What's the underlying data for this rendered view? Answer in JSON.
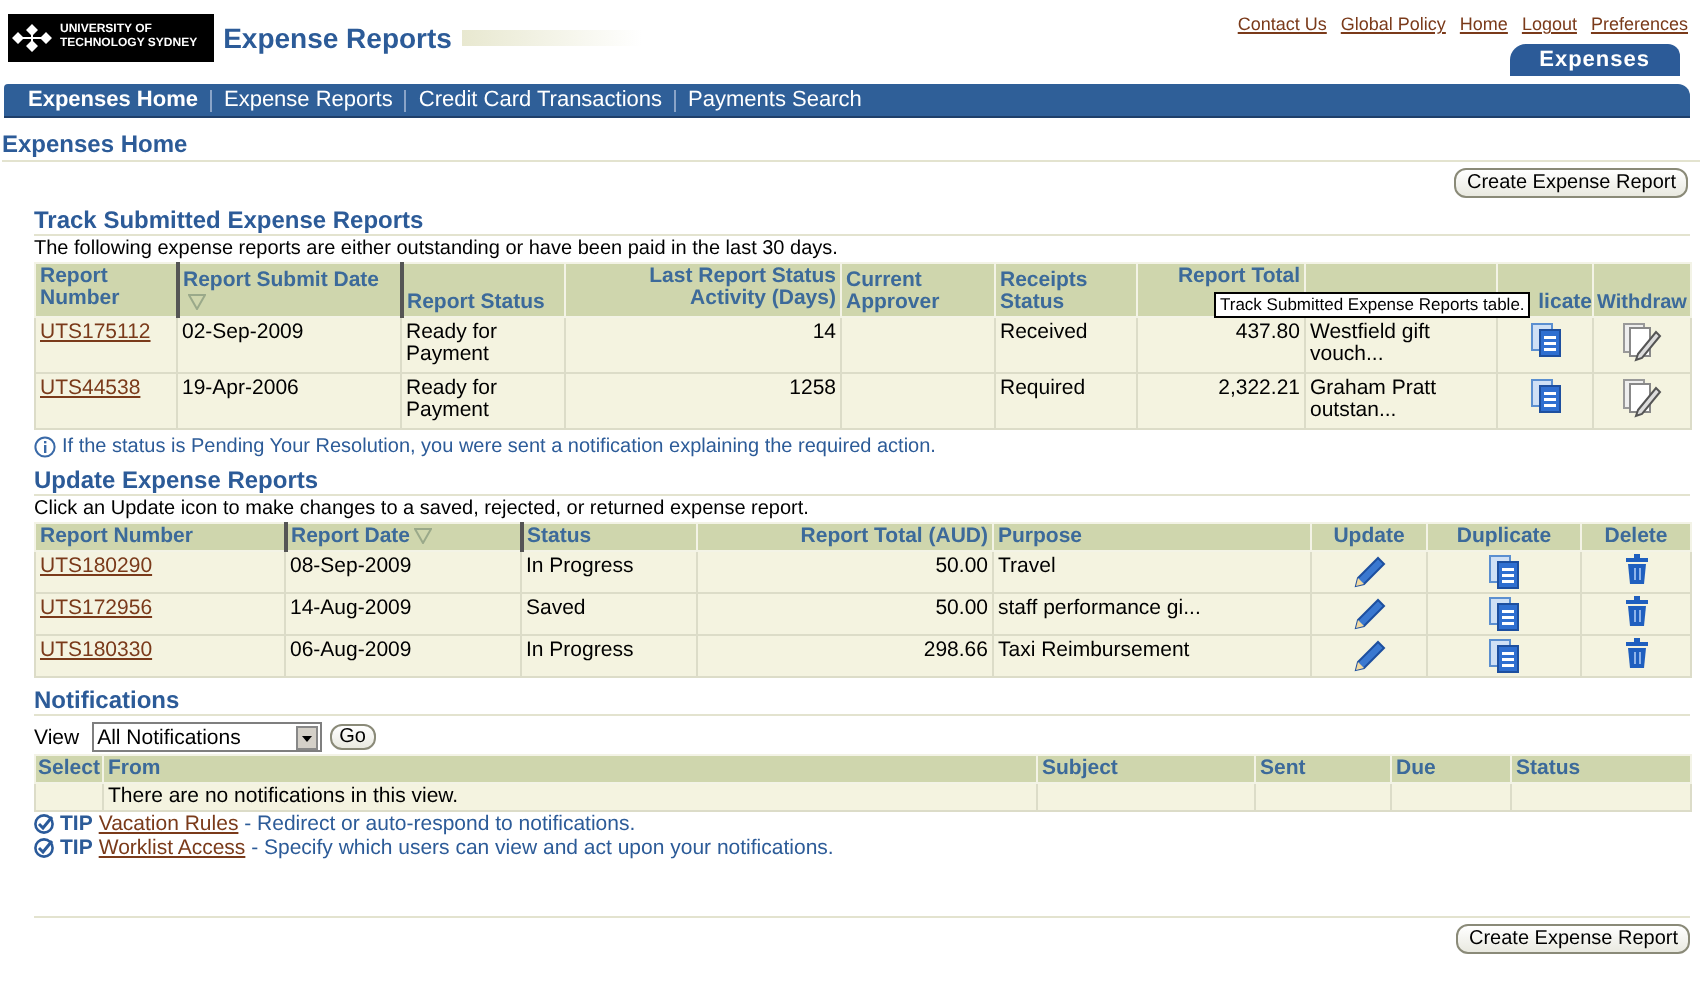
{
  "header": {
    "logo_lines": [
      "UNIVERSITY OF",
      "TECHNOLOGY SYDNEY"
    ],
    "title": "Expense Reports"
  },
  "global_links": [
    "Contact Us",
    "Global Policy",
    "Home",
    "Logout",
    "Preferences"
  ],
  "tabs": [
    {
      "label": "Expenses",
      "selected": true
    }
  ],
  "nav": [
    {
      "label": "Expenses Home",
      "selected": true
    },
    {
      "label": "Expense Reports",
      "selected": false
    },
    {
      "label": "Credit Card Transactions",
      "selected": false
    },
    {
      "label": "Payments Search",
      "selected": false
    }
  ],
  "page_title": "Expenses Home",
  "top_button": "Create Expense Report",
  "track": {
    "title": "Track Submitted Expense Reports",
    "description": "The following expense reports are either outstanding or have been paid in the last 30 days.",
    "columns": [
      {
        "label": "Report Number",
        "kind": "link",
        "sorted": false
      },
      {
        "label": "Report Submit Date",
        "kind": "text",
        "sorted": true
      },
      {
        "label": "Report Status",
        "kind": "text",
        "sorted": false
      },
      {
        "label": "Last Report Status Activity (Days)",
        "kind": "number",
        "sorted": false
      },
      {
        "label": "Current Approver",
        "kind": "text",
        "sorted": false
      },
      {
        "label": "Receipts Status",
        "kind": "text",
        "sorted": false
      },
      {
        "label": "Report Total",
        "kind": "number",
        "sorted": false
      },
      {
        "kind": "text"
      },
      {
        "label": "licate",
        "kind": "duplicate",
        "sorted": false
      },
      {
        "label": "Withdraw",
        "kind": "withdraw",
        "sorted": false
      }
    ],
    "rows": [
      {
        "cells": [
          "UTS175112",
          "02-Sep-2009",
          "Ready for Payment",
          "14",
          null,
          "Received",
          "437.80",
          "Westfield gift vouch..."
        ]
      },
      {
        "cells": [
          "UTS44538",
          "19-Apr-2006",
          "Ready for Payment",
          "1258",
          null,
          "Required",
          "2,322.21",
          "Graham Pratt outstan..."
        ]
      }
    ],
    "tooltip": "Track Submitted Expense Reports table.",
    "note": "If the status is Pending Your Resolution, you were sent a notification explaining the required action."
  },
  "update": {
    "title": "Update Expense Reports",
    "description": "Click an Update icon to make changes to a saved, rejected, or returned expense report.",
    "columns": [
      {
        "label": "Report Number",
        "kind": "link",
        "sorted": false
      },
      {
        "label": "Report Date",
        "kind": "text",
        "sorted": true
      },
      {
        "label": "Status",
        "kind": "text",
        "sorted": false
      },
      {
        "label": "Report Total (AUD)",
        "kind": "number",
        "sorted": false
      },
      {
        "label": "Purpose",
        "kind": "text",
        "sorted": false
      },
      {
        "label": "Update",
        "kind": "update",
        "sorted": false
      },
      {
        "label": "Duplicate",
        "kind": "duplicate",
        "sorted": false
      },
      {
        "label": "Delete",
        "kind": "delete",
        "sorted": false
      }
    ],
    "rows": [
      {
        "cells": [
          "UTS180290",
          "08-Sep-2009",
          "In Progress",
          "50.00",
          "Travel"
        ]
      },
      {
        "cells": [
          "UTS172956",
          "14-Aug-2009",
          "Saved",
          "50.00",
          "staff performance gi..."
        ]
      },
      {
        "cells": [
          "UTS180330",
          "06-Aug-2009",
          "In Progress",
          "298.66",
          "Taxi Reimbursement"
        ]
      }
    ]
  },
  "notifications": {
    "title": "Notifications",
    "view_label": "View",
    "view_value": "All Notifications",
    "go_button": "Go",
    "columns": [
      "Select",
      "From",
      "Subject",
      "Sent",
      "Due",
      "Status"
    ],
    "empty_message": "There are no notifications in this view.",
    "tips": [
      {
        "label": "TIP",
        "link": "Vacation Rules",
        "text": " - Redirect or auto-respond to notifications."
      },
      {
        "label": "TIP",
        "link": "Worklist Access",
        "text": " - Specify which users can view and act upon your notifications."
      }
    ]
  },
  "bottom_button": "Create Expense Report"
}
